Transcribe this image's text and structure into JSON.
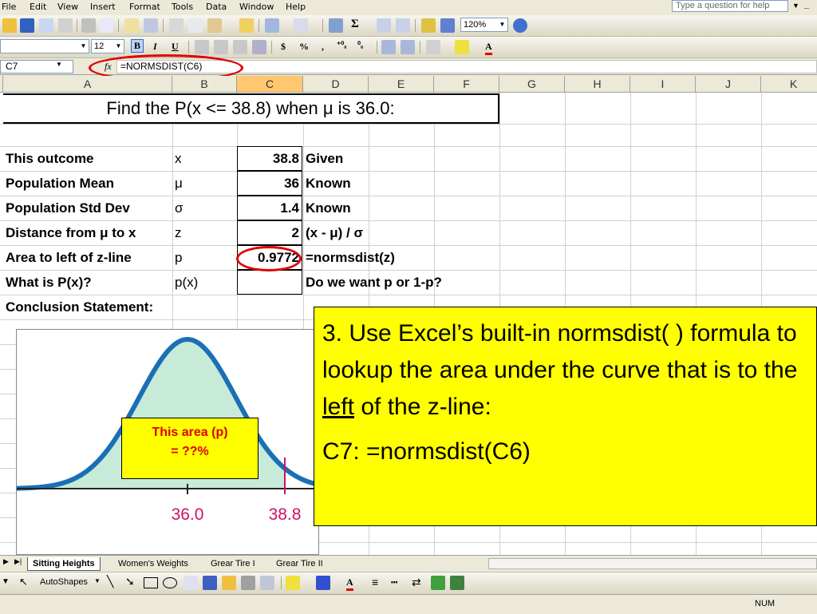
{
  "menu": {
    "items": [
      "File",
      "Edit",
      "View",
      "Insert",
      "Format",
      "Tools",
      "Data",
      "Window",
      "Help"
    ],
    "help_placeholder": "Type a question for help"
  },
  "toolbar": {
    "zoom": "120%",
    "font_size": "12",
    "sigma": "Σ",
    "bold": "B",
    "italic": "I",
    "underline": "U",
    "dollar": "$",
    "percent": "%",
    "comma": ",",
    "increase_decimal": "⁺⁰₀",
    "decrease_decimal": "⁰₀"
  },
  "formula_bar": {
    "name_box": "C7",
    "fx": "fx",
    "formula": "=NORMSDIST(C6)"
  },
  "columns": [
    "A",
    "B",
    "C",
    "D",
    "E",
    "F",
    "G",
    "H",
    "I",
    "J",
    "K"
  ],
  "selected_column": "C",
  "sheet": {
    "title": "Find the P(x <= 38.8) when μ is 36.0:",
    "rows": [
      {
        "label": "This outcome",
        "symbol": "x",
        "value": "38.8",
        "note": "Given"
      },
      {
        "label": "Population Mean",
        "symbol": "μ",
        "value": "36",
        "note": "Known"
      },
      {
        "label": "Population Std Dev",
        "symbol": "σ",
        "value": "1.4",
        "note": "Known"
      },
      {
        "label": "Distance from μ to x",
        "symbol": "z",
        "value": "2",
        "note": "(x - μ) / σ"
      },
      {
        "label": "Area to left of z-line",
        "symbol": "p",
        "value": "0.9772",
        "note": "=normsdist(z)"
      },
      {
        "label": "What is P(x)?",
        "symbol": "p(x)",
        "value": "",
        "note": "Do we want p or 1-p?"
      },
      {
        "label": "Conclusion Statement:",
        "symbol": "",
        "value": "",
        "note": ""
      }
    ]
  },
  "chart": {
    "area_label_line1": "This area  (p)",
    "area_label_line2": "= ??%",
    "tick_mean": "36.0",
    "tick_x": "38.8",
    "fill_color": "#c8ead8",
    "curve_color": "#1a6fb5",
    "zline_color": "#d0106a"
  },
  "callout": {
    "text_before": "3. Use Excel’s built-in normsdist( ) formula to lookup the area under the curve that is to the ",
    "underlined": "left",
    "text_after": " of the z-line:",
    "formula": "C7: =normsdist(C6)"
  },
  "tabs": [
    "Sitting Heights",
    "Women's Weights",
    "Grear Tire I",
    "Grear Tire II"
  ],
  "active_tab": "Sitting Heights",
  "drawbar": {
    "autoshapes": "AutoShapes"
  },
  "status": {
    "num": "NUM"
  },
  "colors": {
    "highlight_yellow": "#ffff00",
    "annotation_red": "#e00000",
    "selected_header": "#ffc870"
  }
}
